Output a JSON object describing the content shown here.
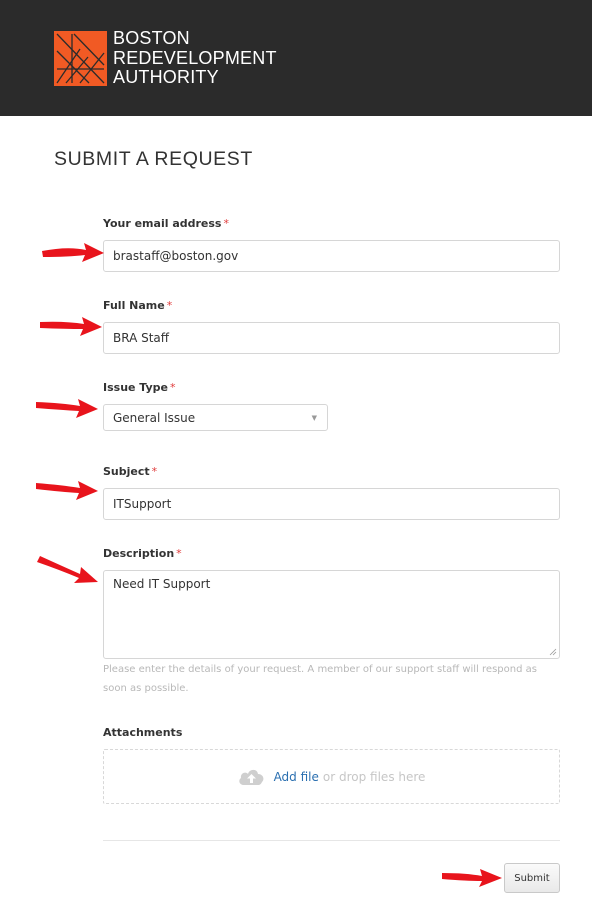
{
  "header": {
    "logo_lines": [
      "BOSTON",
      "REDEVELOPMENT",
      "AUTHORITY"
    ],
    "logo_color": "#f15a24",
    "background": "#2b2b2b"
  },
  "page_title": "SUBMIT A REQUEST",
  "required_mark": "*",
  "form": {
    "email": {
      "label": "Your email address",
      "value": "brastaff@boston.gov"
    },
    "full_name": {
      "label": "Full Name",
      "value": "BRA Staff"
    },
    "issue_type": {
      "label": "Issue Type",
      "value": "General Issue"
    },
    "subject": {
      "label": "Subject",
      "value": "ITSupport"
    },
    "description": {
      "label": "Description",
      "value": "Need IT Support",
      "hint": "Please enter the details of your request. A member of our support staff will respond as soon as possible."
    },
    "attachments": {
      "label": "Attachments",
      "add_file": "Add file",
      "drop_text": "or drop files here",
      "icon": "cloud-upload-icon"
    },
    "submit_label": "Submit"
  },
  "colors": {
    "required": "#e03b3b",
    "link": "#2a6fb0",
    "arrow": "#e8141c"
  }
}
